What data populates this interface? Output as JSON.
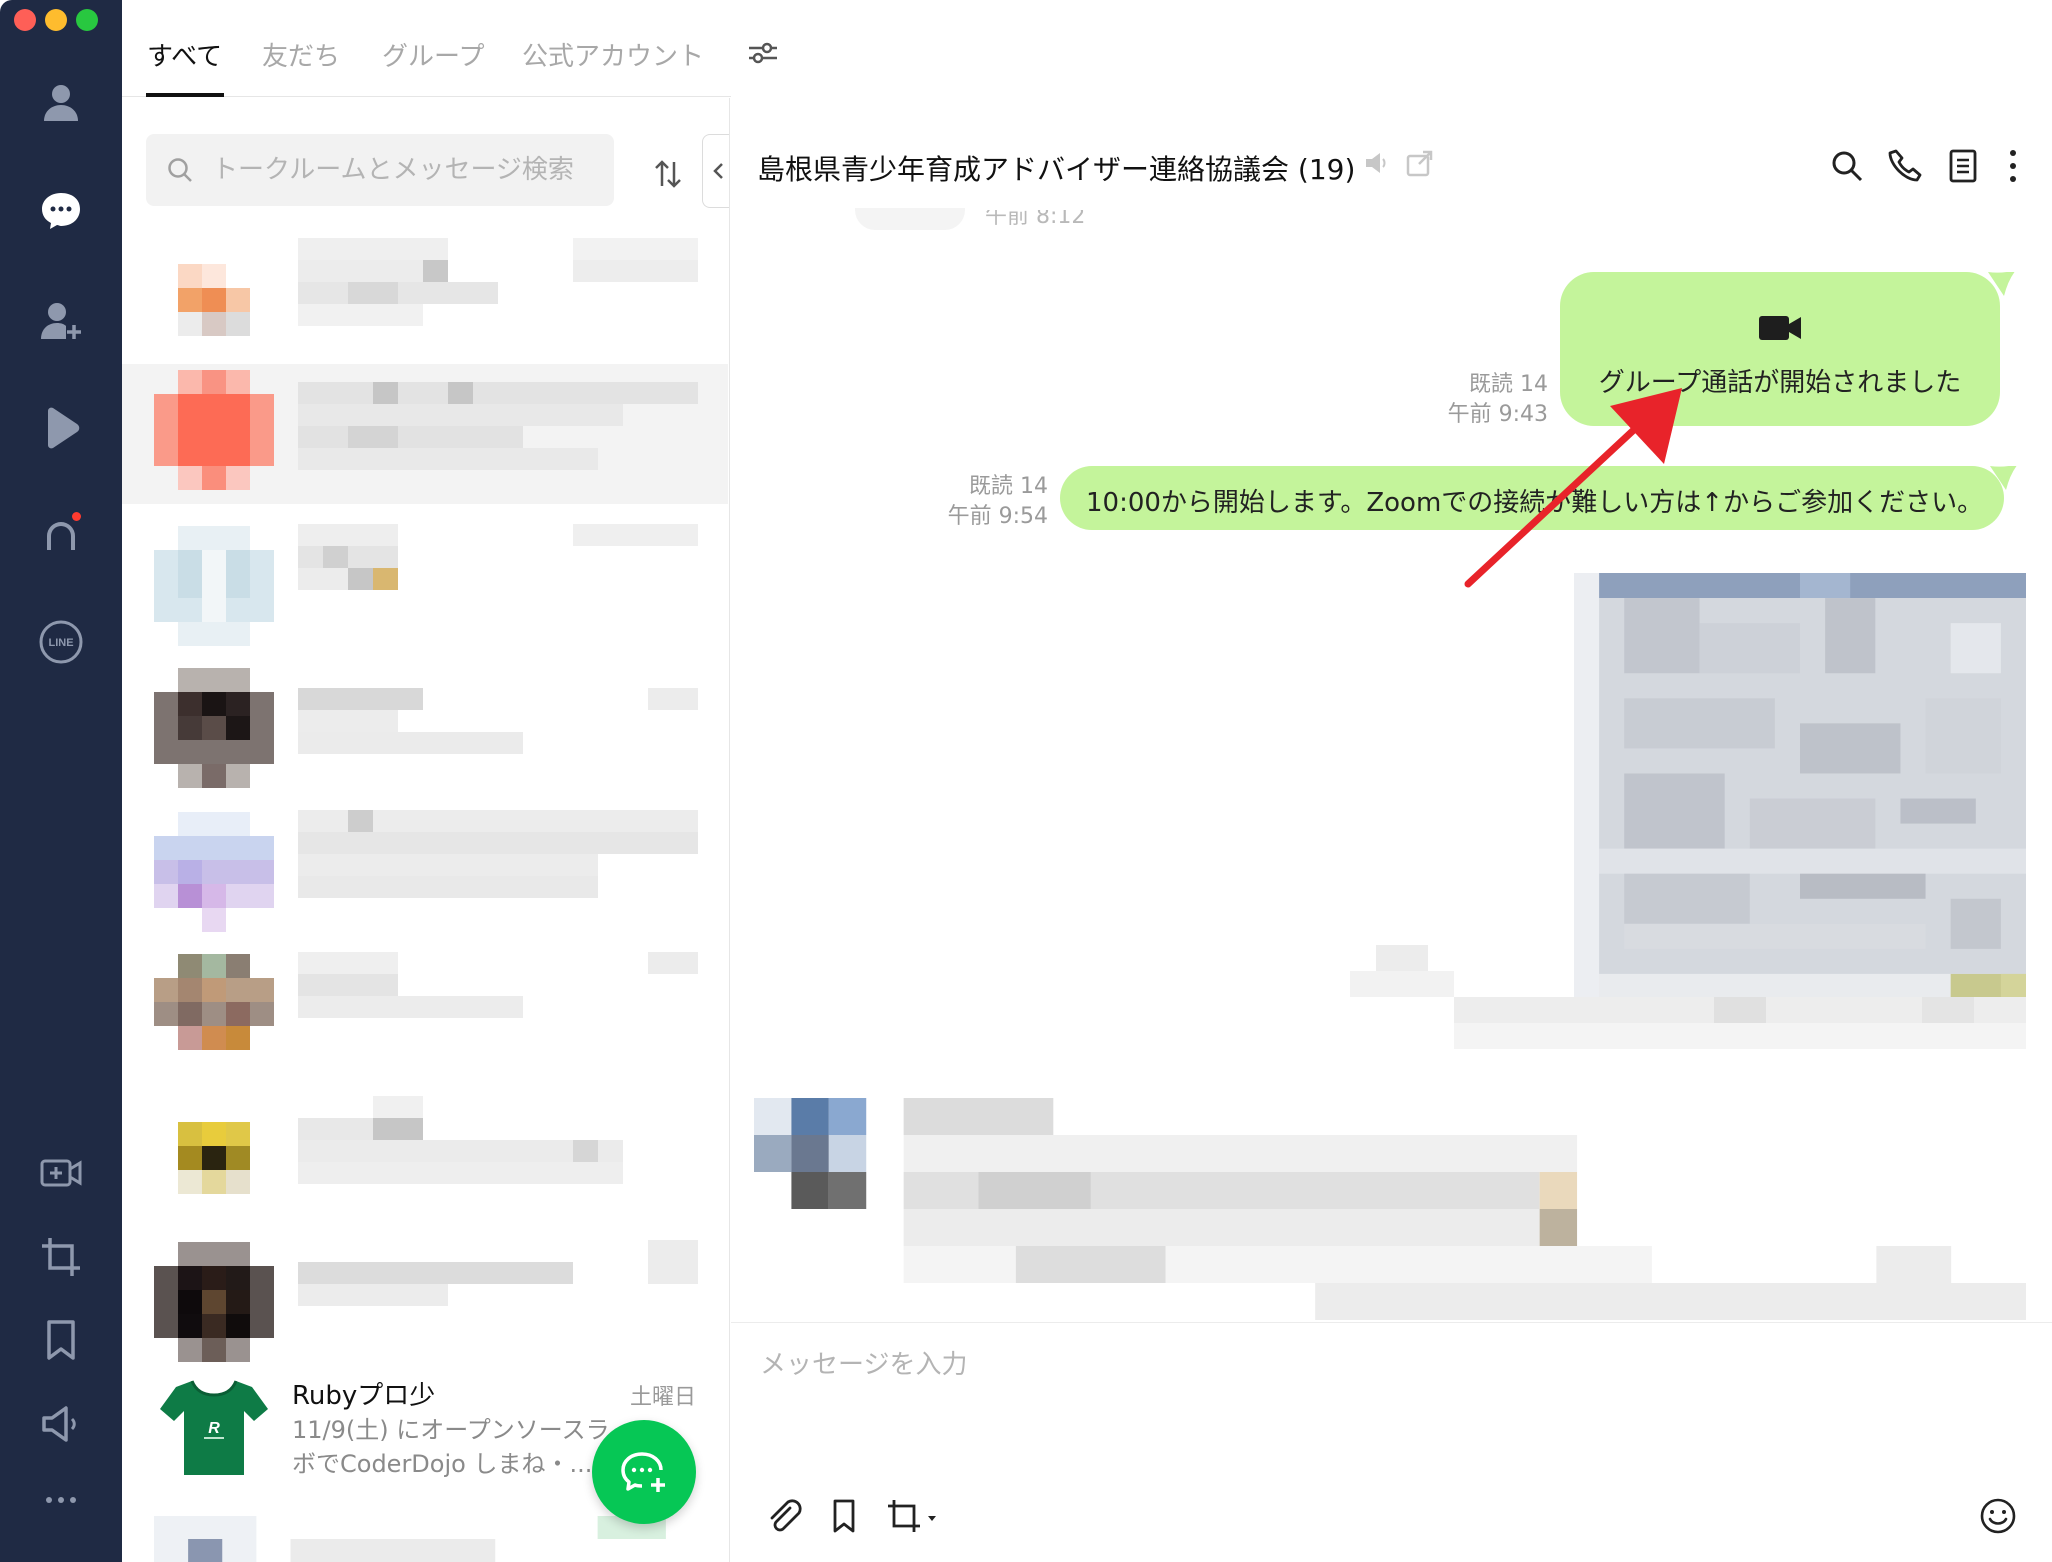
{
  "window": {
    "controls": [
      "close",
      "minimize",
      "zoom"
    ]
  },
  "rail": {
    "icons": [
      "person-icon",
      "chat-icon",
      "add-friend-icon",
      "play-icon",
      "openchat-icon",
      "line-icon",
      "video-call-icon",
      "screenshot-icon",
      "keep-icon",
      "announcement-icon",
      "more-icon"
    ],
    "line_badge": "LINE",
    "has_notification_dot": true
  },
  "tabs": {
    "all": "すべて",
    "friends": "友だち",
    "groups": "グループ",
    "official": "公式アカウント"
  },
  "search": {
    "placeholder": "トークルームとメッセージ検索"
  },
  "chat_list": {
    "ruby": {
      "name": "Rubyプロ少",
      "date": "土曜日",
      "preview": "11/9(土) にオープンソースラボでCoderDojo しまね・..."
    }
  },
  "chat": {
    "title": "島根県青少年育成アドバイザー連絡協議会 (19)",
    "clipped_time": "午前 8:12",
    "messages": [
      {
        "read": "既読 14",
        "time": "午前 9:43",
        "text": "グループ通話が開始されました",
        "kind": "call"
      },
      {
        "read": "既読 14",
        "time": "午前 9:54",
        "text": "10:00から開始します。Zoomでの接続が難しい方は↑からご参加ください。",
        "kind": "text"
      }
    ],
    "composer_placeholder": "メッセージを入力"
  },
  "colors": {
    "rail": "#1f2a44",
    "bubble": "#c4f49b",
    "fab": "#06c755",
    "annotation_arrow": "#e8232a"
  }
}
